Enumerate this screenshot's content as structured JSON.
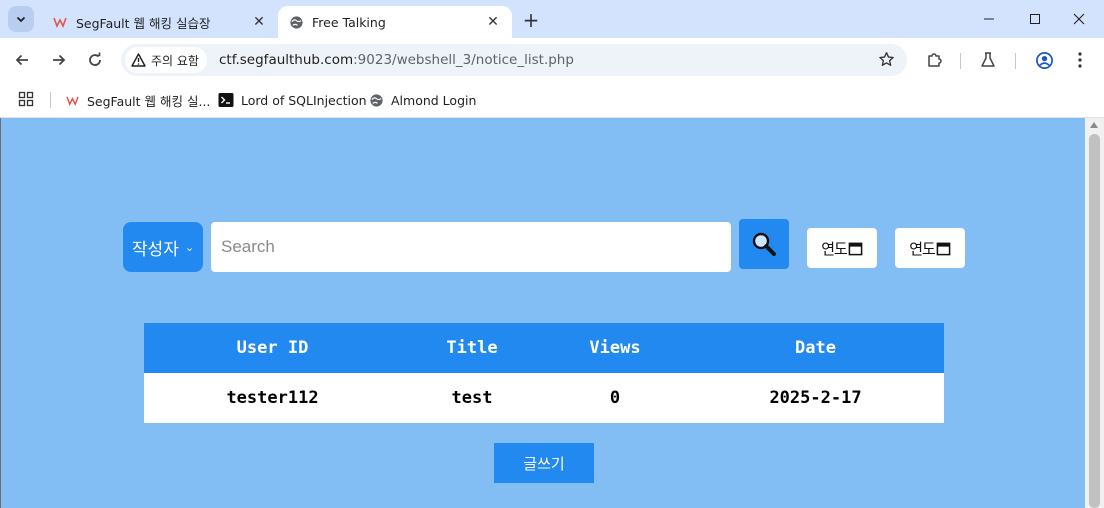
{
  "browser": {
    "tabs": [
      {
        "title": "SegFault 웹 해킹 실습장",
        "active": false,
        "favicon": "segfault-logo-icon"
      },
      {
        "title": "Free Talking",
        "active": true,
        "favicon": "globe-icon"
      }
    ],
    "security_chip": "주의 요함",
    "url_host": "ctf.segfaulthub.com",
    "url_path": ":9023/webshell_3/notice_list.php",
    "bookmarks": [
      {
        "label": "SegFault 웹 해킹 실...",
        "icon": "segfault-logo-icon"
      },
      {
        "label": "Lord of SQLInjection",
        "icon": "terminal-icon"
      },
      {
        "label": "Almond Login",
        "icon": "globe-icon"
      }
    ]
  },
  "page": {
    "search": {
      "filter_label": "작성자",
      "placeholder": "Search",
      "date_start_label": "연도",
      "date_end_label": "연도"
    },
    "table": {
      "headers": [
        "User ID",
        "Title",
        "Views",
        "Date"
      ],
      "rows": [
        [
          "tester112",
          "test",
          "0",
          "2025-2-17"
        ]
      ]
    },
    "write_button": "글쓰기"
  },
  "colors": {
    "page_bg": "#82bdf4",
    "accent": "#2189ef",
    "tabstrip": "#d3e3fd"
  }
}
